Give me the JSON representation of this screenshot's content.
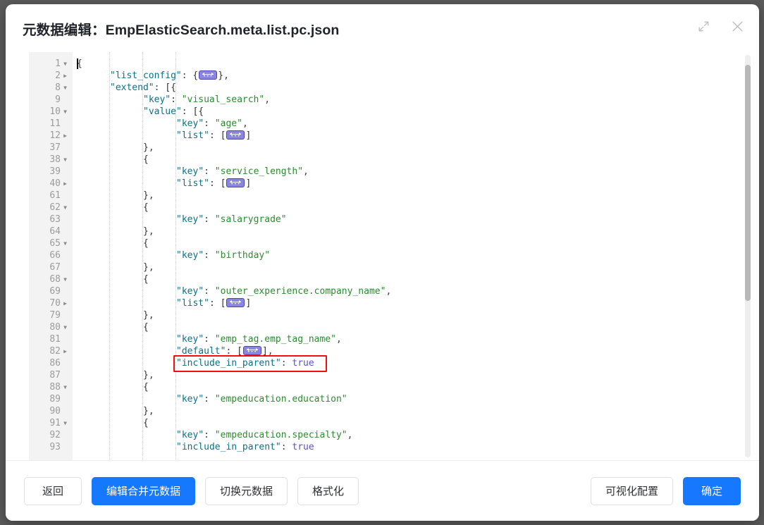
{
  "dialog": {
    "title": "元数据编辑：EmpElasticSearch.meta.list.pc.json",
    "expand_icon": "expand-arrows-icon",
    "close_icon": "close-icon"
  },
  "editor": {
    "language": "json",
    "cursor_line": 1,
    "folded_widget_glyph": "↔",
    "lines": [
      {
        "num": "1",
        "fold": "open",
        "indent": 0,
        "tokens": [
          {
            "t": "br",
            "v": "{"
          }
        ]
      },
      {
        "num": "2",
        "fold": "closed",
        "indent": 1,
        "tokens": [
          {
            "t": "k",
            "v": "\"list_config\""
          },
          {
            "t": "p",
            "v": ": "
          },
          {
            "t": "br",
            "v": "{"
          },
          {
            "t": "widget",
            "v": ""
          },
          {
            "t": "br",
            "v": "}"
          },
          {
            "t": "p",
            "v": ","
          }
        ]
      },
      {
        "num": "8",
        "fold": "open",
        "indent": 1,
        "tokens": [
          {
            "t": "k",
            "v": "\"extend\""
          },
          {
            "t": "p",
            "v": ": "
          },
          {
            "t": "br",
            "v": "[{"
          }
        ]
      },
      {
        "num": "9",
        "fold": "none",
        "indent": 2,
        "tokens": [
          {
            "t": "k",
            "v": "\"key\""
          },
          {
            "t": "p",
            "v": ": "
          },
          {
            "t": "s",
            "v": "\"visual_search\""
          },
          {
            "t": "p",
            "v": ","
          }
        ]
      },
      {
        "num": "10",
        "fold": "open",
        "indent": 2,
        "tokens": [
          {
            "t": "k",
            "v": "\"value\""
          },
          {
            "t": "p",
            "v": ": "
          },
          {
            "t": "br",
            "v": "[{"
          }
        ]
      },
      {
        "num": "11",
        "fold": "none",
        "indent": 3,
        "tokens": [
          {
            "t": "k",
            "v": "\"key\""
          },
          {
            "t": "p",
            "v": ": "
          },
          {
            "t": "s",
            "v": "\"age\""
          },
          {
            "t": "p",
            "v": ","
          }
        ]
      },
      {
        "num": "12",
        "fold": "closed",
        "indent": 3,
        "tokens": [
          {
            "t": "k",
            "v": "\"list\""
          },
          {
            "t": "p",
            "v": ": "
          },
          {
            "t": "br",
            "v": "["
          },
          {
            "t": "widget",
            "v": ""
          },
          {
            "t": "br",
            "v": "]"
          }
        ]
      },
      {
        "num": "37",
        "fold": "none",
        "indent": 2,
        "tokens": [
          {
            "t": "br",
            "v": "}"
          },
          {
            "t": "p",
            "v": ","
          }
        ]
      },
      {
        "num": "38",
        "fold": "open",
        "indent": 2,
        "tokens": [
          {
            "t": "br",
            "v": "{"
          }
        ]
      },
      {
        "num": "39",
        "fold": "none",
        "indent": 3,
        "tokens": [
          {
            "t": "k",
            "v": "\"key\""
          },
          {
            "t": "p",
            "v": ": "
          },
          {
            "t": "s",
            "v": "\"service_length\""
          },
          {
            "t": "p",
            "v": ","
          }
        ]
      },
      {
        "num": "40",
        "fold": "closed",
        "indent": 3,
        "tokens": [
          {
            "t": "k",
            "v": "\"list\""
          },
          {
            "t": "p",
            "v": ": "
          },
          {
            "t": "br",
            "v": "["
          },
          {
            "t": "widget",
            "v": ""
          },
          {
            "t": "br",
            "v": "]"
          }
        ]
      },
      {
        "num": "61",
        "fold": "none",
        "indent": 2,
        "tokens": [
          {
            "t": "br",
            "v": "}"
          },
          {
            "t": "p",
            "v": ","
          }
        ]
      },
      {
        "num": "62",
        "fold": "open",
        "indent": 2,
        "tokens": [
          {
            "t": "br",
            "v": "{"
          }
        ]
      },
      {
        "num": "63",
        "fold": "none",
        "indent": 3,
        "tokens": [
          {
            "t": "k",
            "v": "\"key\""
          },
          {
            "t": "p",
            "v": ": "
          },
          {
            "t": "s",
            "v": "\"salarygrade\""
          }
        ]
      },
      {
        "num": "64",
        "fold": "none",
        "indent": 2,
        "tokens": [
          {
            "t": "br",
            "v": "}"
          },
          {
            "t": "p",
            "v": ","
          }
        ]
      },
      {
        "num": "65",
        "fold": "open",
        "indent": 2,
        "tokens": [
          {
            "t": "br",
            "v": "{"
          }
        ]
      },
      {
        "num": "66",
        "fold": "none",
        "indent": 3,
        "tokens": [
          {
            "t": "k",
            "v": "\"key\""
          },
          {
            "t": "p",
            "v": ": "
          },
          {
            "t": "s",
            "v": "\"birthday\""
          }
        ]
      },
      {
        "num": "67",
        "fold": "none",
        "indent": 2,
        "tokens": [
          {
            "t": "br",
            "v": "}"
          },
          {
            "t": "p",
            "v": ","
          }
        ]
      },
      {
        "num": "68",
        "fold": "open",
        "indent": 2,
        "tokens": [
          {
            "t": "br",
            "v": "{"
          }
        ]
      },
      {
        "num": "69",
        "fold": "none",
        "indent": 3,
        "tokens": [
          {
            "t": "k",
            "v": "\"key\""
          },
          {
            "t": "p",
            "v": ": "
          },
          {
            "t": "s",
            "v": "\"outer_experience.company_name\""
          },
          {
            "t": "p",
            "v": ","
          }
        ]
      },
      {
        "num": "70",
        "fold": "closed",
        "indent": 3,
        "tokens": [
          {
            "t": "k",
            "v": "\"list\""
          },
          {
            "t": "p",
            "v": ": "
          },
          {
            "t": "br",
            "v": "["
          },
          {
            "t": "widget",
            "v": ""
          },
          {
            "t": "br",
            "v": "]"
          }
        ]
      },
      {
        "num": "79",
        "fold": "none",
        "indent": 2,
        "tokens": [
          {
            "t": "br",
            "v": "}"
          },
          {
            "t": "p",
            "v": ","
          }
        ]
      },
      {
        "num": "80",
        "fold": "open",
        "indent": 2,
        "tokens": [
          {
            "t": "br",
            "v": "{"
          }
        ]
      },
      {
        "num": "81",
        "fold": "none",
        "indent": 3,
        "tokens": [
          {
            "t": "k",
            "v": "\"key\""
          },
          {
            "t": "p",
            "v": ": "
          },
          {
            "t": "s",
            "v": "\"emp_tag.emp_tag_name\""
          },
          {
            "t": "p",
            "v": ","
          }
        ]
      },
      {
        "num": "82",
        "fold": "closed",
        "indent": 3,
        "tokens": [
          {
            "t": "k",
            "v": "\"default\""
          },
          {
            "t": "p",
            "v": ": "
          },
          {
            "t": "br",
            "v": "["
          },
          {
            "t": "widget",
            "v": ""
          },
          {
            "t": "br",
            "v": "]"
          },
          {
            "t": "p",
            "v": ","
          }
        ]
      },
      {
        "num": "86",
        "fold": "none",
        "indent": 3,
        "tokens": [
          {
            "t": "k",
            "v": "\"include_in_parent\""
          },
          {
            "t": "p",
            "v": ": "
          },
          {
            "t": "b",
            "v": "true"
          }
        ]
      },
      {
        "num": "87",
        "fold": "none",
        "indent": 2,
        "tokens": [
          {
            "t": "br",
            "v": "}"
          },
          {
            "t": "p",
            "v": ","
          }
        ]
      },
      {
        "num": "88",
        "fold": "open",
        "indent": 2,
        "tokens": [
          {
            "t": "br",
            "v": "{"
          }
        ]
      },
      {
        "num": "89",
        "fold": "none",
        "indent": 3,
        "tokens": [
          {
            "t": "k",
            "v": "\"key\""
          },
          {
            "t": "p",
            "v": ": "
          },
          {
            "t": "s",
            "v": "\"empeducation.education\""
          }
        ]
      },
      {
        "num": "90",
        "fold": "none",
        "indent": 2,
        "tokens": [
          {
            "t": "br",
            "v": "}"
          },
          {
            "t": "p",
            "v": ","
          }
        ]
      },
      {
        "num": "91",
        "fold": "open",
        "indent": 2,
        "tokens": [
          {
            "t": "br",
            "v": "{"
          }
        ]
      },
      {
        "num": "92",
        "fold": "none",
        "indent": 3,
        "tokens": [
          {
            "t": "k",
            "v": "\"key\""
          },
          {
            "t": "p",
            "v": ": "
          },
          {
            "t": "s",
            "v": "\"empeducation.specialty\""
          },
          {
            "t": "p",
            "v": ","
          }
        ]
      },
      {
        "num": "93",
        "fold": "none",
        "indent": 3,
        "tokens": [
          {
            "t": "k",
            "v": "\"include_in_parent\""
          },
          {
            "t": "p",
            "v": ": "
          },
          {
            "t": "b",
            "v": "true"
          }
        ]
      }
    ],
    "highlight": {
      "line_num": "86",
      "text": "\"include_in_parent\": true",
      "color": "#f40f0f"
    }
  },
  "footer": {
    "left_buttons": [
      {
        "label": "返回",
        "style": "default"
      },
      {
        "label": "编辑合并元数据",
        "style": "primary"
      },
      {
        "label": "切换元数据",
        "style": "default"
      },
      {
        "label": "格式化",
        "style": "default"
      }
    ],
    "right_buttons": [
      {
        "label": "可视化配置",
        "style": "default"
      },
      {
        "label": "确定",
        "style": "primary"
      }
    ]
  },
  "colors": {
    "primary": "#1677ff",
    "highlight": "#f40f0f",
    "gutter_bg": "#f3f3f3",
    "key": "#0b7285",
    "string": "#2e8b30",
    "boolean": "#5b4fd6"
  }
}
